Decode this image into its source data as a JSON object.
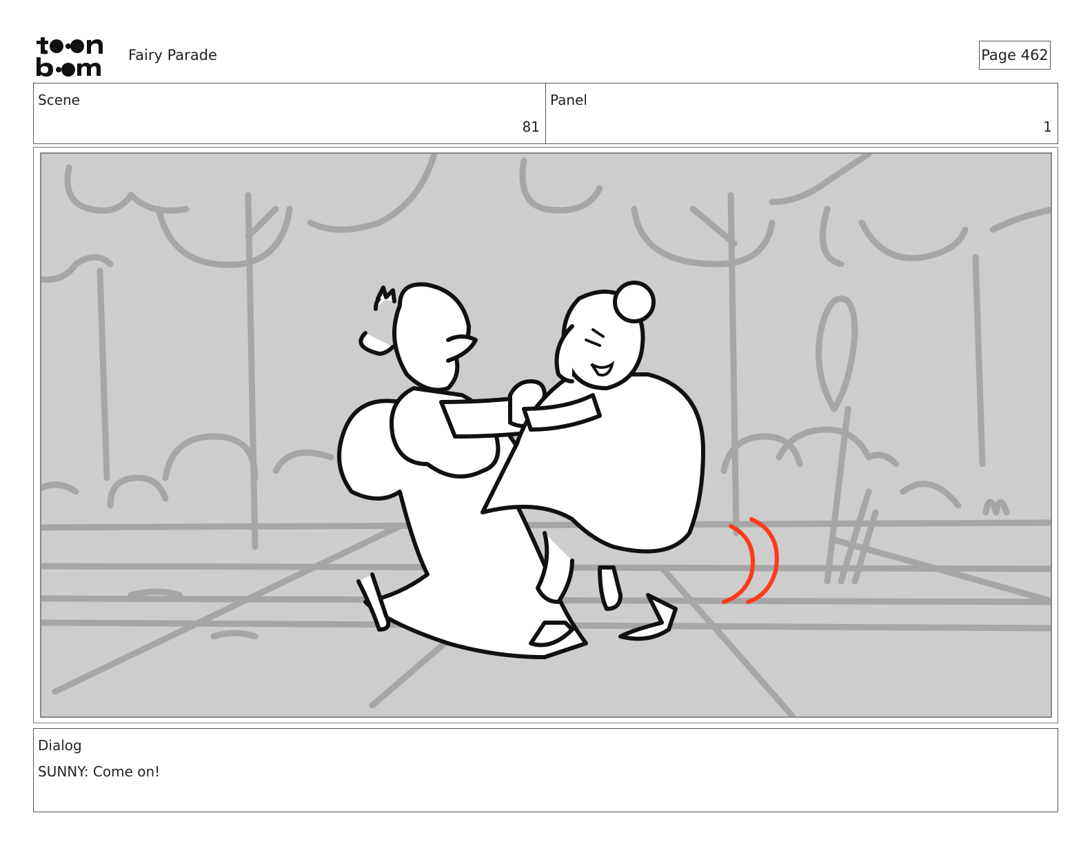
{
  "header": {
    "logo": {
      "name": "toon-boom-logo",
      "text": "toon boom"
    },
    "project_title": "Fairy Parade",
    "page_label": "Page 462"
  },
  "info": {
    "scene_label": "Scene",
    "scene_value": "81",
    "panel_label": "Panel",
    "panel_value": "1"
  },
  "panel_image": {
    "description_icon": "storyboard-sketch",
    "colors": {
      "background": "#cdcdcd",
      "sketch_lines": "#a6a6a6",
      "ink": "#111111",
      "motion_accent": "#ff3a1a"
    }
  },
  "dialog": {
    "label": "Dialog",
    "text": "SUNNY: Come on!"
  }
}
